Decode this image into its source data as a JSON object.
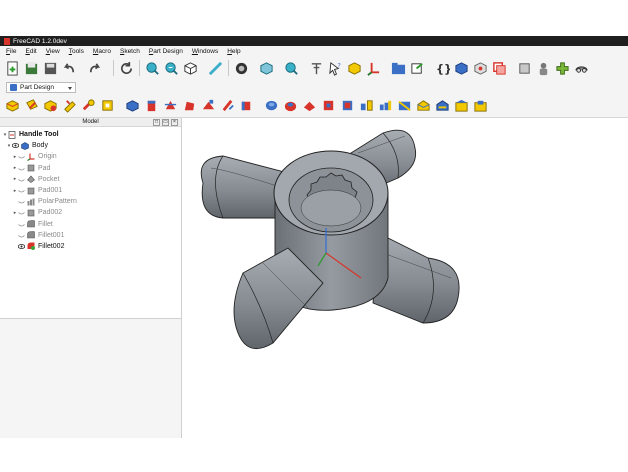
{
  "window": {
    "title": "FreeCAD 1.2.0dev"
  },
  "menu": {
    "items": [
      "File",
      "Edit",
      "View",
      "Tools",
      "Macro",
      "Sketch",
      "Part Design",
      "Windows",
      "Help"
    ]
  },
  "workbench": {
    "selected": "Part Design"
  },
  "model_panel": {
    "title": "Model",
    "root": "Handle Tool",
    "body": "Body",
    "items": [
      {
        "label": "Origin",
        "hidden": true,
        "expandable": true
      },
      {
        "label": "Pad",
        "hidden": true,
        "expandable": true
      },
      {
        "label": "Pocket",
        "hidden": true,
        "expandable": true
      },
      {
        "label": "Pad001",
        "hidden": true,
        "expandable": true
      },
      {
        "label": "PolarPattern",
        "hidden": true,
        "expandable": false
      },
      {
        "label": "Pad002",
        "hidden": true,
        "expandable": true
      },
      {
        "label": "Fillet",
        "hidden": true,
        "expandable": false
      },
      {
        "label": "Fillet001",
        "hidden": true,
        "expandable": false
      },
      {
        "label": "Fillet002",
        "hidden": false,
        "expandable": false
      }
    ]
  },
  "colors": {
    "accent": "#3a6fc5",
    "partdesign_red": "#d7342b",
    "model_gray": "#8a9096",
    "selected_green": "#3aa33a"
  }
}
